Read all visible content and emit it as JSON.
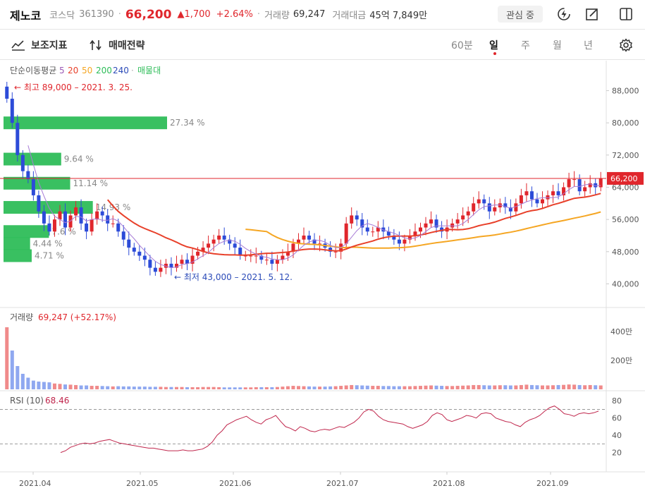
{
  "header": {
    "stock_name": "제노코",
    "market": "코스닥",
    "code": "361390",
    "price": "66,200",
    "change": "▲1,700",
    "change_pct": "+2.64%",
    "volume_label": "거래량",
    "volume_value": "69,247",
    "amount_label": "거래대금",
    "amount_value": "45억 7,849만",
    "favorite_label": "관심 중"
  },
  "toolbar": {
    "indicator_label": "보조지표",
    "strategy_label": "매매전략",
    "periods": [
      "60분",
      "일",
      "주",
      "월",
      "년"
    ],
    "active_period": "일"
  },
  "chart_data": {
    "type": "candlestick",
    "legend": {
      "label": "단순이동평균",
      "ma_periods": [
        {
          "label": "5",
          "color": "#9b59b6"
        },
        {
          "label": "20",
          "color": "#e8402a"
        },
        {
          "label": "50",
          "color": "#f5a623"
        },
        {
          "label": "200",
          "color": "#2ebd59"
        },
        {
          "label": "240",
          "color": "#2c4bb8"
        }
      ],
      "volume_profile_label": "매물대",
      "volume_profile_color": "#2ebd59"
    },
    "price_axis": {
      "ticks": [
        "88,000",
        "80,000",
        "72,000",
        "64,000",
        "56,000",
        "48,000",
        "40,000"
      ],
      "ylim": [
        35000,
        93000
      ]
    },
    "current_price_label": "66,200",
    "current_price": 66200,
    "high_annotation": "← 최고 89,000 – 2021. 3. 25.",
    "low_annotation": "← 최저 43,000 – 2021. 5. 12.",
    "volume_profile": [
      {
        "pct": "27.34 %",
        "value": 27.34,
        "price": 80000
      },
      {
        "pct": "9.64 %",
        "value": 9.64,
        "price": 71000
      },
      {
        "pct": "11.14 %",
        "value": 11.14,
        "price": 65000
      },
      {
        "pct": "14.93 %",
        "value": 14.93,
        "price": 59000
      },
      {
        "pct": "7.6 %",
        "value": 7.6,
        "price": 53000
      },
      {
        "pct": "4.44 %",
        "value": 4.44,
        "price": 50000
      },
      {
        "pct": "4.71 %",
        "value": 4.71,
        "price": 47000
      }
    ],
    "volume_panel": {
      "label": "거래량",
      "value": "69,247 (+52.17%)",
      "ticks": [
        "400만",
        "200만"
      ]
    },
    "rsi_panel": {
      "label": "RSI (10)",
      "value": "68.46",
      "ticks": [
        "80",
        "60",
        "40",
        "20"
      ],
      "ylim": [
        0,
        90
      ]
    },
    "x_ticks": [
      "2021.04",
      "2021.05",
      "2021.06",
      "2021.07",
      "2021.08",
      "2021.09"
    ],
    "close_series": [
      86000,
      80000,
      72000,
      68000,
      66000,
      62000,
      58000,
      55000,
      53000,
      56000,
      58000,
      54000,
      57000,
      59000,
      55000,
      53000,
      56000,
      58000,
      57000,
      55000,
      55000,
      53000,
      51000,
      49000,
      48000,
      47000,
      46000,
      44000,
      43000,
      44000,
      45000,
      44000,
      45000,
      46000,
      45000,
      47000,
      48000,
      49000,
      50000,
      51000,
      52000,
      51000,
      50000,
      49000,
      47000,
      47000,
      47000,
      47000,
      46000,
      46000,
      45000,
      46000,
      47000,
      48000,
      50000,
      51000,
      52000,
      51000,
      50000,
      50000,
      49000,
      48000,
      48000,
      50000,
      55000,
      57000,
      56000,
      54000,
      53000,
      53000,
      54000,
      53000,
      52000,
      51000,
      50000,
      51000,
      52000,
      53000,
      54000,
      55000,
      56000,
      54000,
      53000,
      54000,
      55000,
      56000,
      57000,
      58000,
      60000,
      61000,
      60000,
      58000,
      59000,
      60000,
      59000,
      58000,
      60000,
      62000,
      63000,
      61000,
      60000,
      61000,
      62000,
      63000,
      62000,
      64000,
      66000,
      66000,
      63000,
      64000,
      65000,
      64000,
      66200
    ],
    "rsi_series": [
      20,
      22,
      26,
      28,
      30,
      31,
      30,
      31,
      33,
      34,
      35,
      33,
      31,
      30,
      29,
      28,
      27,
      26,
      25,
      25,
      24,
      23,
      22,
      22,
      22,
      23,
      22,
      22,
      23,
      24,
      27,
      32,
      40,
      45,
      52,
      55,
      58,
      60,
      62,
      58,
      55,
      53,
      58,
      60,
      63,
      56,
      50,
      48,
      45,
      50,
      48,
      45,
      44,
      46,
      47,
      46,
      48,
      50,
      49,
      52,
      55,
      60,
      67,
      70,
      68,
      62,
      58,
      56,
      55,
      54,
      53,
      50,
      48,
      50,
      52,
      56,
      63,
      66,
      64,
      58,
      56,
      58,
      60,
      63,
      62,
      60,
      65,
      66,
      65,
      60,
      58,
      56,
      55,
      52,
      50,
      55,
      58,
      60,
      63,
      68,
      72,
      74,
      70,
      65,
      64,
      62,
      65,
      66,
      65,
      66,
      68
    ],
    "volume_series": [
      320,
      200,
      120,
      80,
      60,
      45,
      40,
      38,
      36,
      30,
      28,
      25,
      24,
      22,
      20,
      20,
      18,
      18,
      17,
      16,
      15,
      16,
      15,
      15,
      14,
      14,
      14,
      13,
      13,
      13,
      12,
      12,
      12,
      12,
      11,
      11,
      11,
      12,
      12,
      12,
      11,
      10,
      10,
      10,
      10,
      10,
      10,
      11,
      11,
      11,
      11,
      12,
      14,
      16,
      18,
      17,
      16,
      15,
      14,
      14,
      14,
      15,
      16,
      18,
      20,
      22,
      21,
      20,
      19,
      18,
      18,
      17,
      17,
      16,
      16,
      16,
      16,
      17,
      18,
      19,
      20,
      19,
      18,
      17,
      17,
      18,
      19,
      20,
      22,
      22,
      21,
      20,
      20,
      21,
      21,
      20,
      20,
      22,
      24,
      22,
      21,
      20,
      20,
      21,
      22,
      23,
      25,
      24,
      22,
      21,
      22,
      21,
      20
    ]
  }
}
